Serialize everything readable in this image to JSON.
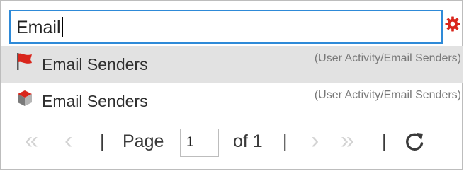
{
  "search": {
    "value": "Email"
  },
  "results": [
    {
      "label": "Email Senders",
      "path": "(User Activity/Email Senders)",
      "icon": "red-flag-icon",
      "selected": true
    },
    {
      "label": "Email Senders",
      "path": "(User Activity/Email Senders)",
      "icon": "filter-cube-icon",
      "selected": false
    }
  ],
  "pager": {
    "page_label": "Page",
    "page_value": "1",
    "of_label": "of 1",
    "separator": "|"
  },
  "colors": {
    "search_border": "#2e8ad8",
    "gear_red": "#d9261c",
    "selected_row": "#e2e2e2",
    "disabled_chevron": "#d3d3d3"
  }
}
